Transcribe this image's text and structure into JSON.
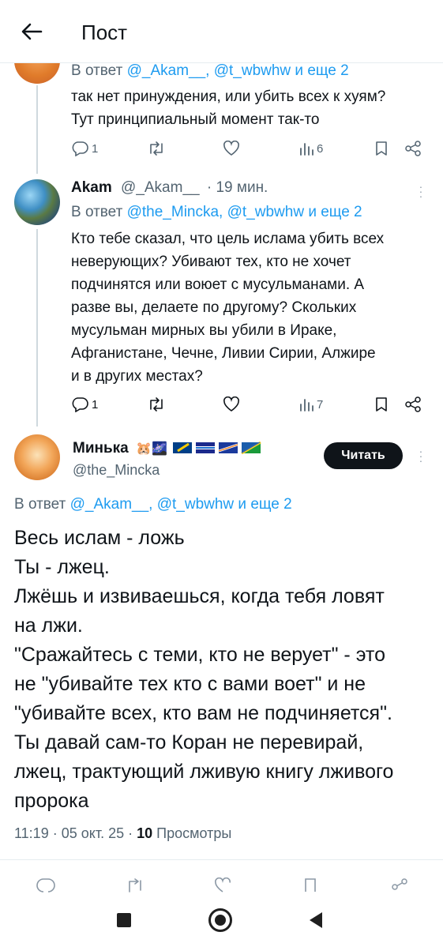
{
  "header": {
    "title": "Пост"
  },
  "tweet1": {
    "reply_prefix": "В ответ ",
    "reply_targets": "@_Akam__, @t_wbwhw и еще 2",
    "text_lines": [
      "так нет принуждения, или убить всех к хуям?",
      "Тут принципиальный момент так-то"
    ],
    "reply_count": "1",
    "views": "6"
  },
  "tweet2": {
    "name": "Akam",
    "handle": "@_Akam__",
    "time": "· 19 мин.",
    "reply_prefix": "В ответ ",
    "reply_targets": "@the_Mincka, @t_wbwhw и еще 2",
    "text_lines": [
      "Кто тебе сказал, что цель ислама убить всех",
      "неверующих? Убивают тех, кто не хочет",
      "подчинятся или воюет с мусульманами. А",
      "разве вы, делаете по другому? Скольких",
      "мусульман мирных вы убили в Ираке,",
      "Афганистане, Чечне, Ливии Сирии, Алжире",
      "и в других местах?"
    ],
    "reply_count": "1",
    "views": "7"
  },
  "main": {
    "name": "Минька",
    "emoji_badges": "🐹🌌",
    "handle": "@the_Mincka",
    "follow_label": "Читать",
    "reply_prefix": "В ответ ",
    "reply_targets": "@_Akam__, @t_wbwhw и еще 2",
    "text_lines": [
      "Весь ислам - ложь",
      "Ты - лжец.",
      "Лжёшь и извиваешься, когда тебя ловят",
      "на лжи.",
      "\"Сражайтесь с теми, кто не верует\" - это",
      "не \"убивайте тех кто с вами воет\" и не",
      "\"убивайте всех, кто вам не подчиняется\".",
      "Ты давай сам-то Коран не перевирай,",
      "лжец, трактующий лживую книгу лживого",
      "пророка"
    ],
    "meta_time": "11:19 · 05 окт. 25 · ",
    "meta_views_count": "10",
    "meta_views_label": " Просмотры"
  },
  "colors": {
    "link": "#1d9bf0",
    "muted": "#536471",
    "text": "#0f1419",
    "line": "#cfd9de"
  }
}
